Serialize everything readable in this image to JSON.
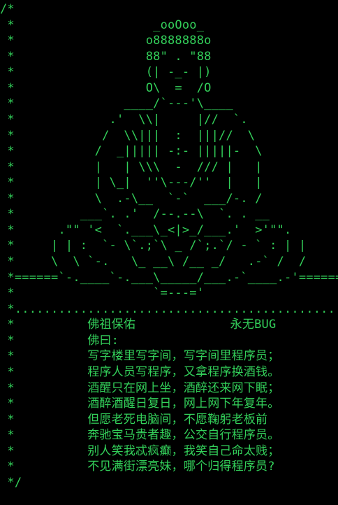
{
  "theme": {
    "background": "#000000",
    "text_color": "#33d05a"
  },
  "lines": [
    "/*",
    " *                   _ooOoo_",
    " *                  o8888888o",
    " *                  88\" . \"88",
    " *                  (| -_- |)",
    " *                  O\\  =  /O",
    " *               ____/`---'\\____",
    " *             .'  \\\\|     |//  `.",
    " *            /  \\\\|||  :  |||//  \\",
    " *           /  _||||| -:- |||||-  \\",
    " *           |   | \\\\\\  -  /// |   |",
    " *           | \\_|  ''\\---/''  |   |",
    " *           \\  .-\\__  `-`  ___/-. /",
    " *         ___`. .'  /--.--\\  `. . __",
    " *      .\"\" '<  `.___\\_<|>_/___.'  >'\"\".",
    " *     | | :  `- \\`.;`\\ _ /`;.`/ - ` : | |",
    " *     \\  \\ `-.   \\_ __\\ /__ _/   .-` /  /",
    " *======`-.____`-.___\\_____/___.-`____.-'======",
    " *                   `=---='",
    " *.............................................",
    " *          佛祖保佑             永无BUG",
    " *          佛曰:",
    " *          写字楼里写字间，写字间里程序员；",
    " *          程序人员写程序，又拿程序换酒钱。",
    " *          酒醒只在网上坐，酒醉还来网下眠；",
    " *          酒醉酒醒日复日，网上网下年复年。",
    " *          但愿老死电脑间，不愿鞠躬老板前",
    " *          奔驰宝马贵者趣，公交自行程序员。",
    " *          别人笑我忒疯癫，我笑自己命太贱；",
    " *          不见满街漂亮妹，哪个归得程序员?",
    " */"
  ]
}
